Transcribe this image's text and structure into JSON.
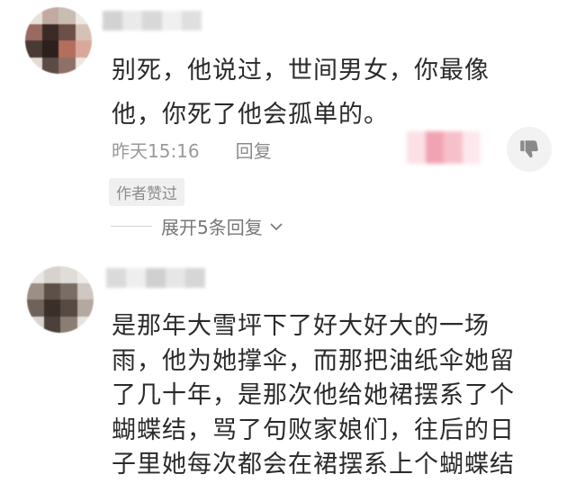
{
  "comment1": {
    "text_lines": [
      "别死，他说过，世间男女，你最像",
      "他，你死了他会孤单的。"
    ],
    "time": "昨天15:16",
    "reply_label": "回复",
    "liked_badge": "作者赞过",
    "expand_label": "展开5条回复"
  },
  "comment2": {
    "text_lines": [
      "是那年大雪坪下了好大好大的一场",
      "雨，他为她撑伞，而那把油纸伞她留",
      "了几十年，是那次他给她裙摆系了个",
      "蝴蝶结，骂了句败家娘们，往后的日",
      "子里她每次都会在裙摆系上个蝴蝶结"
    ]
  },
  "icons": {
    "dislike": "thumbs-down-icon",
    "expand": "chevron-down-icon"
  },
  "colors": {
    "text": "#2a2a2a",
    "meta": "#9a9a9a",
    "badge_bg": "#f0f0f0",
    "pink_blur": "#f2a3b3"
  }
}
